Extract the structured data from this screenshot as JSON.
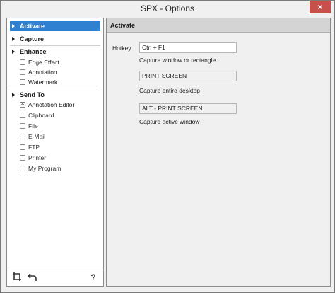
{
  "window": {
    "title": "SPX - Options",
    "close_label": "×"
  },
  "sidebar": {
    "groups": {
      "activate": "Activate",
      "capture": "Capture",
      "enhance": "Enhance",
      "send_to": "Send To"
    },
    "enhance_items": [
      {
        "label": "Edge Effect",
        "checked": false
      },
      {
        "label": "Annotation",
        "checked": false
      },
      {
        "label": "Watermark",
        "checked": false
      }
    ],
    "send_to_items": [
      {
        "label": "Annotation Editor",
        "checked": true
      },
      {
        "label": "Clipboard",
        "checked": false
      },
      {
        "label": "File",
        "checked": false
      },
      {
        "label": "E-Mail",
        "checked": false
      },
      {
        "label": "FTP",
        "checked": false
      },
      {
        "label": "Printer",
        "checked": false
      },
      {
        "label": "My Program",
        "checked": false
      }
    ],
    "footer": {
      "crop_icon": "crop-icon",
      "undo_icon": "undo-icon",
      "help_label": "?"
    }
  },
  "main": {
    "header": "Activate",
    "hotkey_label": "Hotkey",
    "hotkey_value": "Ctrl + F1",
    "caption_1": "Capture window or rectangle",
    "field_2_value": "PRINT SCREEN",
    "caption_2": "Capture entire desktop",
    "field_3_value": "ALT - PRINT SCREEN",
    "caption_3": "Capture active window"
  }
}
